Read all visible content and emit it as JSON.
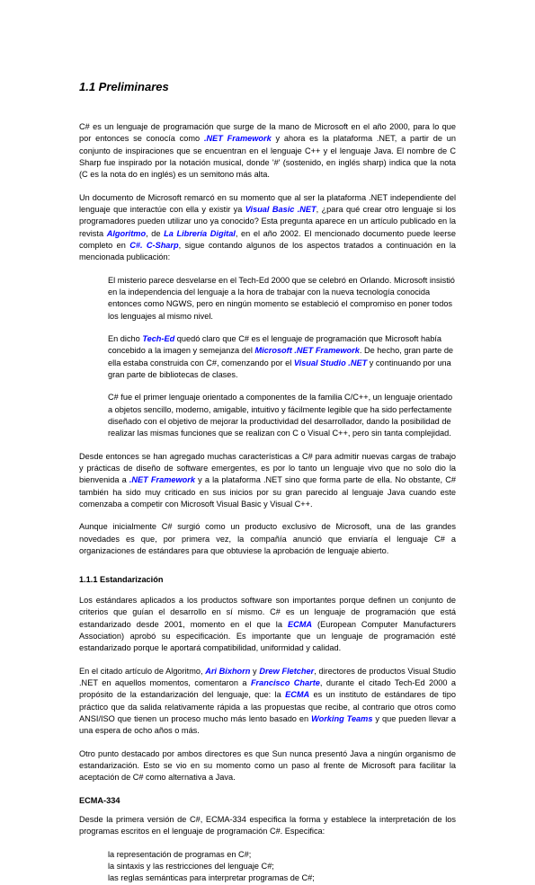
{
  "title": "1.1 Preliminares",
  "para1_a": "C# es un lenguaje de programación que surge de la mano de Microsoft en el año 2000, para lo que por entonces se conocía como ",
  "para1_link1": ".NET Framework",
  "para1_b": " y ahora es la plataforma .NET, a partir de un conjunto de inspiraciones que se encuentran en el lenguaje C++ y el lenguaje Java. El nombre de C Sharp fue inspirado por la notación musical, donde '#' (sostenido, en inglés sharp) indica que la nota (C es la nota do en inglés) es un semitono más alta.",
  "para2_a": "Un documento de Microsoft remarcó en su momento que al ser la plataforma .NET independiente del lenguaje que interactúe con ella y existir ya ",
  "para2_link1": "Visual Basic .NET",
  "para2_b": ", ¿para qué crear otro lenguaje si los programadores pueden utilizar uno ya conocido? Esta pregunta aparece en un artículo publicado en la revista ",
  "para2_link2": "Algoritmo",
  "para2_c": ", de ",
  "para2_link3": "La Librería Digital",
  "para2_d": ", en el año 2002. El mencionado documento puede leerse completo en ",
  "para2_link4": "C#. C-Sharp",
  "para2_e": ", sigue contando algunos de los aspectos tratados a continuación en la mencionada publicación:",
  "para3": "El misterio parece desvelarse en el Tech-Ed 2000 que se celebró en Orlando. Microsoft insistió en la independencia del lenguaje a la hora de trabajar con la nueva tecnología conocida entonces como NGWS, pero en ningún momento se estableció el compromiso en poner todos los lenguajes al mismo nivel.",
  "para4_a": "En dicho ",
  "para4_link1": "Tech-Ed",
  "para4_b": " quedó claro que C# es el lenguaje de programación que Microsoft había concebido a la imagen y semejanza del ",
  "para4_link2": "Microsoft .NET Framework",
  "para4_c": ". De hecho, gran parte de ella estaba construida con C#, comenzando por el ",
  "para4_link3": "Visual Studio .NET",
  "para4_d": " y continuando por una gran parte de bibliotecas de clases.",
  "para5": "C# fue el primer lenguaje orientado a componentes de la familia C/C++, un lenguaje orientado a objetos sencillo, moderno, amigable, intuitivo y fácilmente legible que ha sido perfectamente diseñado con el objetivo de mejorar la productividad del desarrollador, dando la posibilidad de realizar las mismas funciones que se realizan con C o Visual C++, pero sin tanta complejidad.",
  "para6_a": "Desde entonces se han agregado muchas características a C# para admitir nuevas cargas de trabajo y prácticas de diseño de software emergentes, es por lo tanto un lenguaje vivo que no solo dio la bienvenida a ",
  "para6_link1": ".NET Framework",
  "para6_b": " y a la plataforma .NET sino que forma parte de ella. No obstante, C# también ha sido muy criticado en sus inicios por su gran parecido al lenguaje Java cuando este comenzaba a competir con Microsoft Visual Basic y Visual C++.",
  "para7": "Aunque inicialmente C# surgió como un producto exclusivo de Microsoft, una de las grandes novedades es que, por primera vez, la compañía anunció que enviaría el lenguaje C# a organizaciones de estándares para que obtuviese la aprobación de lenguaje abierto.",
  "sectionNum": "1.1.1 Estandarización",
  "para8_a": "Los estándares aplicados a los productos software son importantes porque definen un conjunto de criterios que guían el desarrollo en sí mismo. C# es un lenguaje de programación que está estandarizado desde 2001, momento en el que la ",
  "para8_link1": "ECMA",
  "para8_b": " (European Computer Manufacturers Association) aprobó su especificación. Es importante que un lenguaje de programación esté estandarizado porque le aportará compatibilidad, uniformidad y calidad.",
  "para9_a": "En el citado artículo de Algoritmo, ",
  "para9_link1": "Ari Bixhorn",
  "para9_b": " y ",
  "para9_link2": "Drew Fletcher",
  "para9_c": ", directores de productos Visual Studio .NET en aquellos momentos, comentaron a ",
  "para9_link3": "Francisco Charte",
  "para9_d": ", durante el citado Tech-Ed 2000 a propósito de la estandarización del lenguaje, que: la ",
  "para9_link4": "ECMA",
  "para9_e": " es un instituto de estándares de tipo práctico que da salida relativamente rápida a las propuestas que recibe, al contrario que otros como ANSI/ISO que tienen un proceso mucho más lento basado en ",
  "para9_link5": "Working Teams",
  "para9_f": " y que pueden llevar a una espera de ocho años o más.",
  "para10": "Otro punto destacado por ambos directores es que Sun nunca presentó Java a ningún organismo de estandarización. Esto se vio en su momento como un paso al frente de Microsoft para facilitar la aceptación de C# como alternativa a Java.",
  "sub1": "ECMA-334",
  "para11": "Desde la primera versión de C#, ECMA-334 especifica la forma y establece la interpretación de los programas escritos en el lenguaje de programación C#. Especifica:",
  "bullet1": "la representación de programas en C#;",
  "bullet2": "la sintaxis y las restricciones del lenguaje C#;",
  "bullet3": "las reglas semánticas para interpretar programas de C#;"
}
